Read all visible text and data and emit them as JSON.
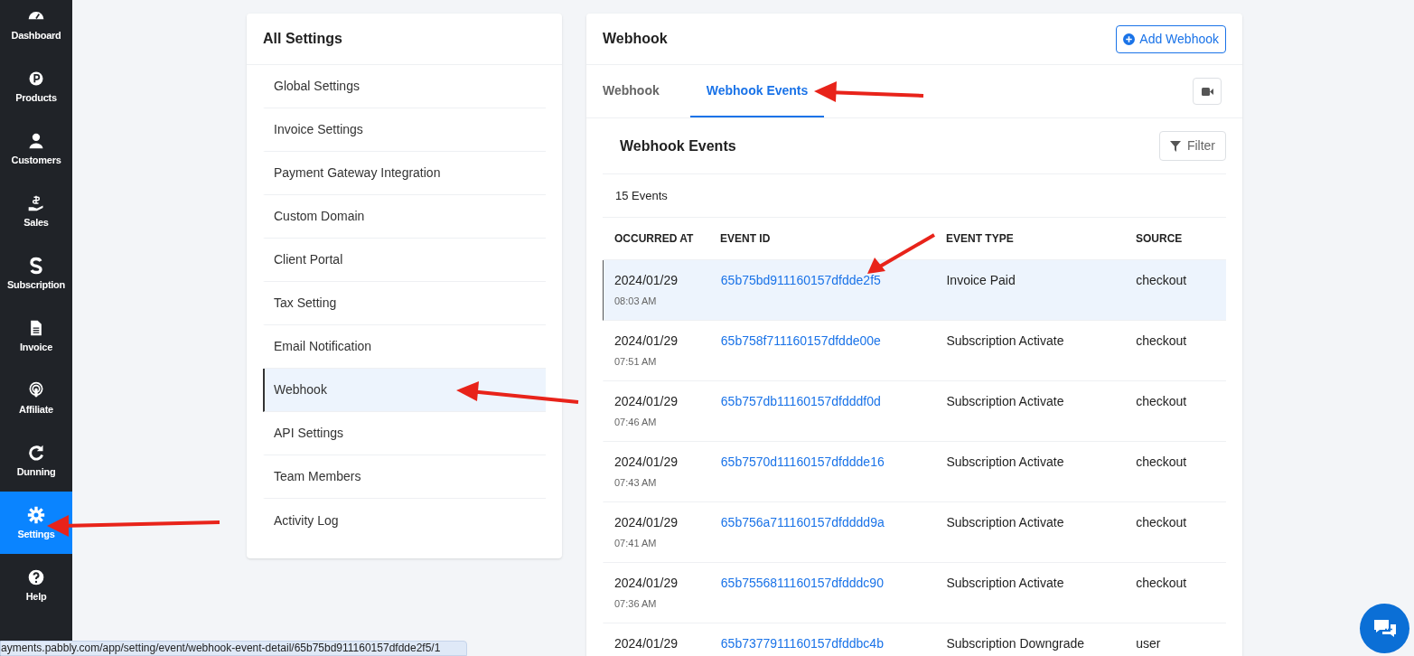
{
  "sidebar": {
    "items": [
      {
        "label": "Dashboard",
        "selected": false
      },
      {
        "label": "Products",
        "selected": false
      },
      {
        "label": "Customers",
        "selected": false
      },
      {
        "label": "Sales",
        "selected": false
      },
      {
        "label": "Subscription",
        "selected": false
      },
      {
        "label": "Invoice",
        "selected": false
      },
      {
        "label": "Affiliate",
        "selected": false
      },
      {
        "label": "Dunning",
        "selected": false
      },
      {
        "label": "Settings",
        "selected": true
      },
      {
        "label": "Help",
        "selected": false
      }
    ]
  },
  "settings_menu": {
    "title": "All Settings",
    "items": [
      {
        "label": "Global Settings",
        "selected": false
      },
      {
        "label": "Invoice Settings",
        "selected": false
      },
      {
        "label": "Payment Gateway Integration",
        "selected": false
      },
      {
        "label": "Custom Domain",
        "selected": false
      },
      {
        "label": "Client Portal",
        "selected": false
      },
      {
        "label": "Tax Setting",
        "selected": false
      },
      {
        "label": "Email Notification",
        "selected": false
      },
      {
        "label": "Webhook",
        "selected": true
      },
      {
        "label": "API Settings",
        "selected": false
      },
      {
        "label": "Team Members",
        "selected": false
      },
      {
        "label": "Activity Log",
        "selected": false
      }
    ]
  },
  "webhook_panel": {
    "title": "Webhook",
    "add_button": "Add Webhook",
    "tabs": [
      {
        "label": "Webhook",
        "selected": false
      },
      {
        "label": "Webhook Events",
        "selected": true
      }
    ],
    "events": {
      "title": "Webhook Events",
      "filter_button": "Filter",
      "count": "15 Events",
      "columns": [
        "OCCURRED AT",
        "EVENT ID",
        "EVENT TYPE",
        "SOURCE"
      ],
      "rows": [
        {
          "date": "2024/01/29",
          "time": "08:03 AM",
          "event_id": "65b75bd911160157dfdde2f5",
          "event_type": "Invoice Paid",
          "source": "checkout",
          "selected": true
        },
        {
          "date": "2024/01/29",
          "time": "07:51 AM",
          "event_id": "65b758f711160157dfdde00e",
          "event_type": "Subscription Activate",
          "source": "checkout",
          "selected": false
        },
        {
          "date": "2024/01/29",
          "time": "07:46 AM",
          "event_id": "65b757db11160157dfdddf0d",
          "event_type": "Subscription Activate",
          "source": "checkout",
          "selected": false
        },
        {
          "date": "2024/01/29",
          "time": "07:43 AM",
          "event_id": "65b7570d11160157dfddde16",
          "event_type": "Subscription Activate",
          "source": "checkout",
          "selected": false
        },
        {
          "date": "2024/01/29",
          "time": "07:41 AM",
          "event_id": "65b756a711160157dfdddd9a",
          "event_type": "Subscription Activate",
          "source": "checkout",
          "selected": false
        },
        {
          "date": "2024/01/29",
          "time": "07:36 AM",
          "event_id": "65b7556811160157dfdddc90",
          "event_type": "Subscription Activate",
          "source": "checkout",
          "selected": false
        },
        {
          "date": "2024/01/29",
          "event_id": "65b7377911160157dfddbc4b",
          "event_type": "Subscription Downgrade",
          "source": "user",
          "selected": false
        }
      ]
    }
  },
  "status_bar": {
    "url": "ayments.pabbly.com/app/setting/event/webhook-event-detail/65b75bd911160157dfdde2f5/1"
  }
}
